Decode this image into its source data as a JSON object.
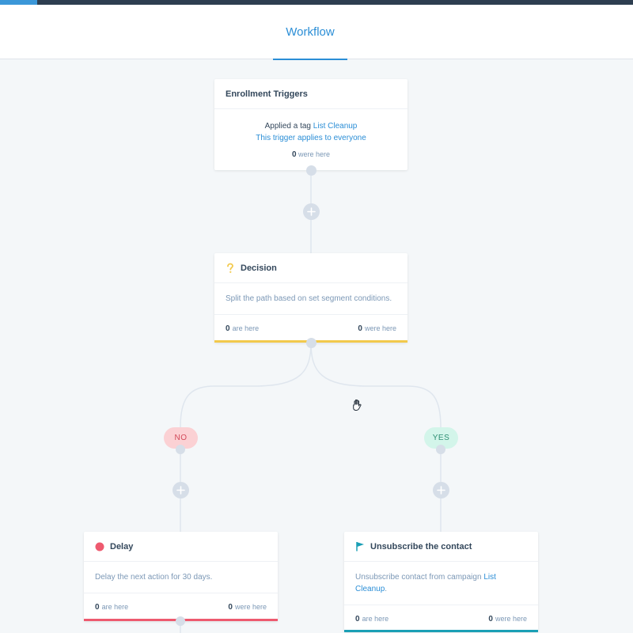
{
  "header": {
    "tab_label": "Workflow"
  },
  "triggers": {
    "title": "Enrollment Triggers",
    "line1_prefix": "Applied a tag",
    "line1_tag": "List Cleanup",
    "line2": "This trigger applies to everyone",
    "count": "0",
    "count_label": "were here"
  },
  "decision": {
    "title": "Decision",
    "description": "Split the path based on set segment conditions.",
    "are_count": "0",
    "are_label": "are here",
    "were_count": "0",
    "were_label": "were here",
    "accent_color": "#f2c94c"
  },
  "branches": {
    "no_label": "NO",
    "yes_label": "YES"
  },
  "delay": {
    "title": "Delay",
    "description": "Delay the next action for 30 days.",
    "are_count": "0",
    "are_label": "are here",
    "were_count": "0",
    "were_label": "were here",
    "accent_color": "#ee5a6f"
  },
  "unsubscribe": {
    "title": "Unsubscribe the contact",
    "description_prefix": "Unsubscribe contact from campaign",
    "description_link": "List Cleanup",
    "description_suffix": ".",
    "are_count": "0",
    "are_label": "are here",
    "were_count": "0",
    "were_label": "were here",
    "accent_color": "#1a9fb5"
  },
  "icons": {
    "decision": "question-mark-icon",
    "delay": "red-dot-icon",
    "unsubscribe": "flag-icon",
    "add": "plus-icon",
    "cursor": "grab-hand-icon"
  }
}
